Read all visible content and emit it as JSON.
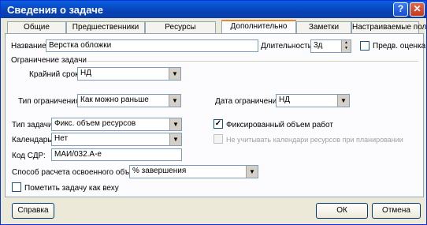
{
  "window": {
    "title": "Сведения о задаче",
    "help_icon": "?",
    "close_icon": "✕"
  },
  "tabs": [
    {
      "label": "Общие"
    },
    {
      "label": "Предшественники"
    },
    {
      "label": "Ресурсы"
    },
    {
      "label": "Дополнительно"
    },
    {
      "label": "Заметки"
    },
    {
      "label": "Настраиваемые поля"
    }
  ],
  "name": {
    "label": "Название:",
    "value": "Верстка обложки"
  },
  "duration": {
    "label": "Длительность:",
    "value": "3д",
    "spin_up": "▲",
    "spin_down": "▼"
  },
  "estimate": {
    "label": "Предв. оценка",
    "checked": false
  },
  "constraint_section": {
    "title": "Ограничение задачи"
  },
  "deadline": {
    "label": "Крайний срок:",
    "value": "НД"
  },
  "constraint_type": {
    "label": "Тип ограничения:",
    "value": "Как можно раньше"
  },
  "constraint_date": {
    "label": "Дата ограничения:",
    "value": "НД"
  },
  "task_type": {
    "label": "Тип задачи:",
    "value": "Фикс. объем ресурсов"
  },
  "effort_driven": {
    "label": "Фиксированный объем работ",
    "checked": true,
    "mark": "✓"
  },
  "calendar": {
    "label": "Календарь:",
    "value": "Нет"
  },
  "ignore_calendars": {
    "label": "Не учитывать календари ресурсов при планировании",
    "checked": false
  },
  "wbs": {
    "label": "Код СДР:",
    "value": "МАИ/032.А-е"
  },
  "earned_value": {
    "label": "Способ расчета освоенного объема:",
    "value": "% завершения"
  },
  "milestone": {
    "label": "Пометить задачу как веху",
    "checked": false
  },
  "buttons": {
    "help": "Справка",
    "ok": "ОК",
    "cancel": "Отмена"
  },
  "dropdown_arrow": "▼"
}
